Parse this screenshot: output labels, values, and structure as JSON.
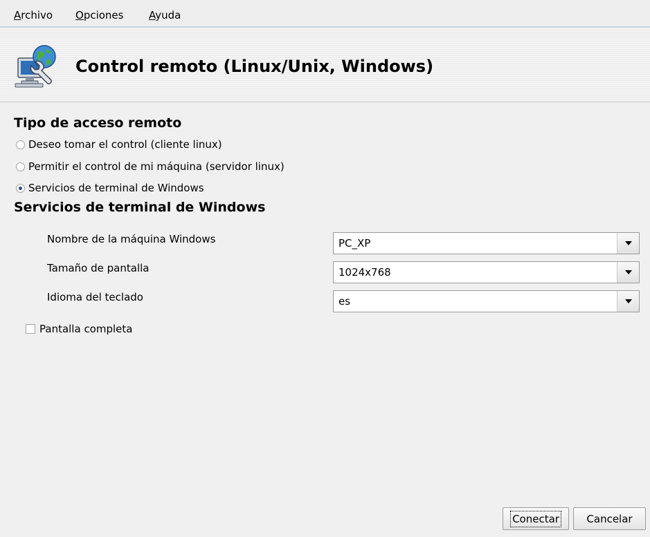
{
  "menubar": {
    "items": [
      {
        "mnemonic": "A",
        "rest": "rchivo"
      },
      {
        "mnemonic": "O",
        "rest": "pciones"
      },
      {
        "mnemonic": "A",
        "rest": "yuda"
      }
    ]
  },
  "header": {
    "icon": "remote-control-computer-icon",
    "title": "Control remoto (Linux/Unix, Windows)"
  },
  "access": {
    "title": "Tipo de acceso remoto",
    "options": [
      {
        "label": "Deseo tomar el control (cliente linux)",
        "selected": false
      },
      {
        "label": "Permitir el control de mi máquina (servidor linux)",
        "selected": false
      },
      {
        "label": "Servicios de terminal de Windows",
        "selected": true
      }
    ]
  },
  "terminal": {
    "title": "Servicios de terminal de Windows",
    "fields": [
      {
        "label": "Nombre de la máquina Windows",
        "value": "PC_XP"
      },
      {
        "label": "Tamaño de pantalla",
        "value": "1024x768"
      },
      {
        "label": "Idioma del teclado",
        "value": "es"
      }
    ],
    "fullscreen": {
      "label": "Pantalla completa",
      "checked": false
    }
  },
  "buttons": {
    "connect": "Conectar",
    "cancel": "Cancelar"
  },
  "colors": {
    "radio_selected": "#2a4f86",
    "menubar_border": "#c9d3dd"
  }
}
